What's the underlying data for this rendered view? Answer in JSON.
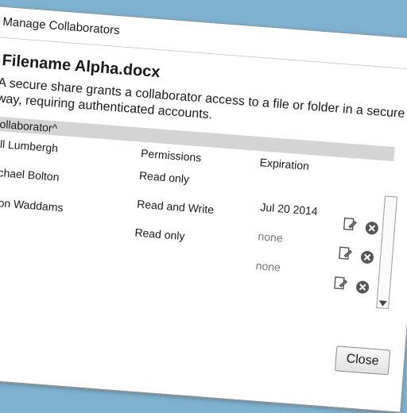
{
  "window": {
    "title": "Manage Collaborators"
  },
  "file": {
    "name": "Filename Alpha.docx",
    "description": "A secure share grants a collaborator access to a file or folder in a secure way, requiring authenticated accounts."
  },
  "table": {
    "columns": {
      "collaborator": "Collaborator^",
      "permissions": "Permissions",
      "expiration": "Expiration"
    },
    "rows": [
      {
        "collaborator": "Bill Lumbergh",
        "permissions": "Read only",
        "expiration": "Jul 20 2014"
      },
      {
        "collaborator": "Michael Bolton",
        "permissions": "Read and Write",
        "expiration": "none"
      },
      {
        "collaborator": "Milton Waddams",
        "permissions": "Read only",
        "expiration": "none"
      }
    ]
  },
  "icons": {
    "edit": "edit-icon",
    "delete": "delete-icon",
    "scroll_down": "chevron-down-icon"
  },
  "buttons": {
    "close": "Close"
  },
  "colors": {
    "background": "#7fb2d0",
    "header_bg": "#d4d4d4",
    "delete_icon": "#555555"
  }
}
